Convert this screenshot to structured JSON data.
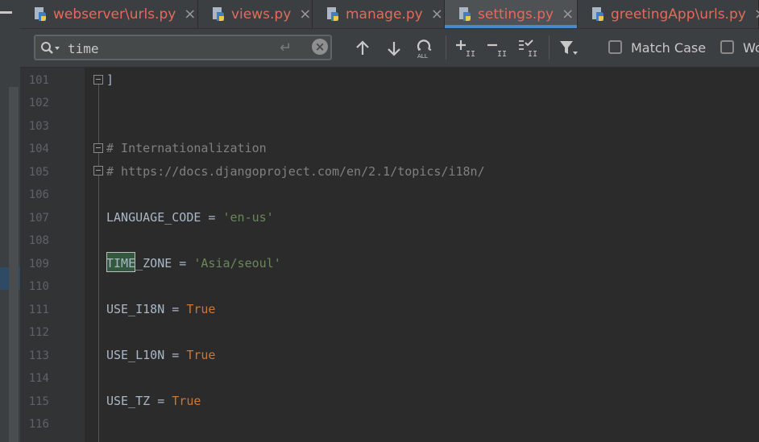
{
  "tabs": [
    {
      "label": "webserver\\urls.py",
      "close": "×",
      "active": false
    },
    {
      "label": "views.py",
      "close": "×",
      "active": false
    },
    {
      "label": "manage.py",
      "close": "×",
      "active": false
    },
    {
      "label": "settings.py",
      "close": "×",
      "active": true
    },
    {
      "label": "greetingApp\\urls.py",
      "close": "×",
      "active": false
    }
  ],
  "find": {
    "query": "time",
    "match_case_label": "Match Case",
    "words_label": "Wo"
  },
  "editor": {
    "lines": [
      {
        "n": "101",
        "text": "]"
      },
      {
        "n": "102",
        "text": ""
      },
      {
        "n": "103",
        "text": ""
      },
      {
        "n": "104",
        "text": "# Internationalization"
      },
      {
        "n": "105",
        "text": "# https://docs.djangoproject.com/en/2.1/topics/i18n/"
      },
      {
        "n": "106",
        "text": ""
      },
      {
        "n": "107",
        "key": "LANGUAGE_CODE",
        "op": " = ",
        "val": "'en-us'"
      },
      {
        "n": "108",
        "text": ""
      },
      {
        "n": "109",
        "key": "TIME_ZONE",
        "op": " = ",
        "val": "'Asia/seoul'"
      },
      {
        "n": "110",
        "text": ""
      },
      {
        "n": "111",
        "key": "USE_I18N",
        "op": " = ",
        "val": "True"
      },
      {
        "n": "112",
        "text": ""
      },
      {
        "n": "113",
        "key": "USE_L10N",
        "op": " = ",
        "val": "True"
      },
      {
        "n": "114",
        "text": ""
      },
      {
        "n": "115",
        "key": "USE_TZ",
        "op": " = ",
        "val": "True"
      },
      {
        "n": "116",
        "text": ""
      }
    ]
  },
  "colors": {
    "accent": "#4a88c7",
    "tab_text": "#e36b5a",
    "string": "#6a8759",
    "keyword": "#cc7832",
    "comment": "#808080"
  }
}
